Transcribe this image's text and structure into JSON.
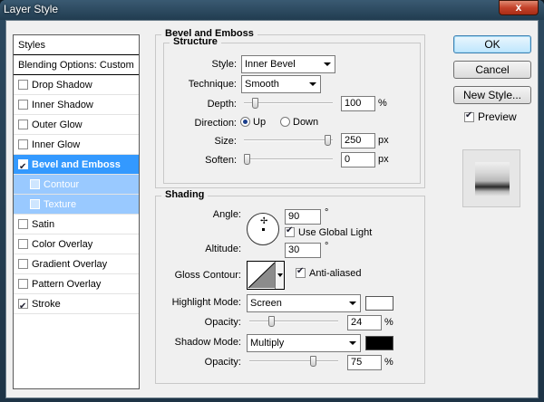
{
  "window": {
    "title": "Layer Style",
    "close_label": "x"
  },
  "styles_list": {
    "header": "Styles",
    "blending": "Blending Options: Custom",
    "items": [
      {
        "label": "Drop Shadow",
        "checked": false
      },
      {
        "label": "Inner Shadow",
        "checked": false
      },
      {
        "label": "Outer Glow",
        "checked": false
      },
      {
        "label": "Inner Glow",
        "checked": false
      },
      {
        "label": "Bevel and Emboss",
        "checked": true,
        "selected": true
      },
      {
        "label": "Contour",
        "checked": false,
        "sub": true
      },
      {
        "label": "Texture",
        "checked": false,
        "sub": true
      },
      {
        "label": "Satin",
        "checked": false
      },
      {
        "label": "Color Overlay",
        "checked": false
      },
      {
        "label": "Gradient Overlay",
        "checked": false
      },
      {
        "label": "Pattern Overlay",
        "checked": false
      },
      {
        "label": "Stroke",
        "checked": true
      }
    ]
  },
  "bevel": {
    "group_title": "Bevel and Emboss",
    "structure_title": "Structure",
    "style_label": "Style:",
    "style_value": "Inner Bevel",
    "technique_label": "Technique:",
    "technique_value": "Smooth",
    "depth_label": "Depth:",
    "depth_value": "100",
    "depth_unit": "%",
    "depth_fraction": 0.1,
    "direction_label": "Direction:",
    "direction_up": "Up",
    "direction_down": "Down",
    "size_label": "Size:",
    "size_value": "250",
    "size_unit": "px",
    "size_fraction": 1.0,
    "soften_label": "Soften:",
    "soften_value": "0",
    "soften_unit": "px",
    "soften_fraction": 0.0
  },
  "shading": {
    "title": "Shading",
    "angle_label": "Angle:",
    "angle_value": "90",
    "angle_unit": "°",
    "global_light_label": "Use Global Light",
    "altitude_label": "Altitude:",
    "altitude_value": "30",
    "altitude_unit": "°",
    "gloss_label": "Gloss Contour:",
    "antialiased_label": "Anti-aliased",
    "highlight_label": "Highlight Mode:",
    "highlight_value": "Screen",
    "highlight_color": "#ffffff",
    "highlight_opacity_label": "Opacity:",
    "highlight_opacity_value": "24",
    "highlight_opacity_fraction": 0.24,
    "shadow_label": "Shadow Mode:",
    "shadow_value": "Multiply",
    "shadow_color": "#000000",
    "shadow_opacity_label": "Opacity:",
    "shadow_opacity_value": "75",
    "shadow_opacity_fraction": 0.75,
    "percent_unit": "%"
  },
  "buttons": {
    "ok": "OK",
    "cancel": "Cancel",
    "new_style": "New Style...",
    "preview": "Preview"
  }
}
